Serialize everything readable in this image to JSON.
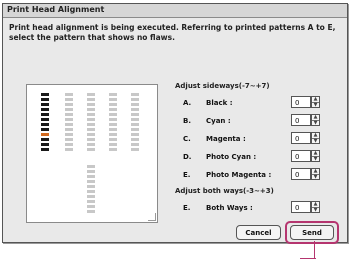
{
  "dialog": {
    "title": "Print Head Alignment",
    "instructions": "Print head alignment is being executed. Referring to printed patterns A to E, select the pattern that shows no flaws."
  },
  "sideways": {
    "heading": "Adjust sideways(-7~+7)",
    "rows": [
      {
        "letter": "A.",
        "name": "Black :",
        "value": "0"
      },
      {
        "letter": "B.",
        "name": "Cyan :",
        "value": "0"
      },
      {
        "letter": "C.",
        "name": "Magenta :",
        "value": "0"
      },
      {
        "letter": "D.",
        "name": "Photo Cyan :",
        "value": "0"
      },
      {
        "letter": "E.",
        "name": "Photo Magenta :",
        "value": "0"
      }
    ]
  },
  "both": {
    "heading": "Adjust both ways(-3~+3)",
    "rows": [
      {
        "letter": "E.",
        "name": "Both Ways :",
        "value": "0"
      }
    ]
  },
  "buttons": {
    "cancel": "Cancel",
    "send": "Send"
  },
  "colors": {
    "highlight": "#b5356f",
    "pattern_dark": "#1a1a1a",
    "pattern_orange": "#d2691e",
    "pattern_light": "#c8c8c8"
  }
}
